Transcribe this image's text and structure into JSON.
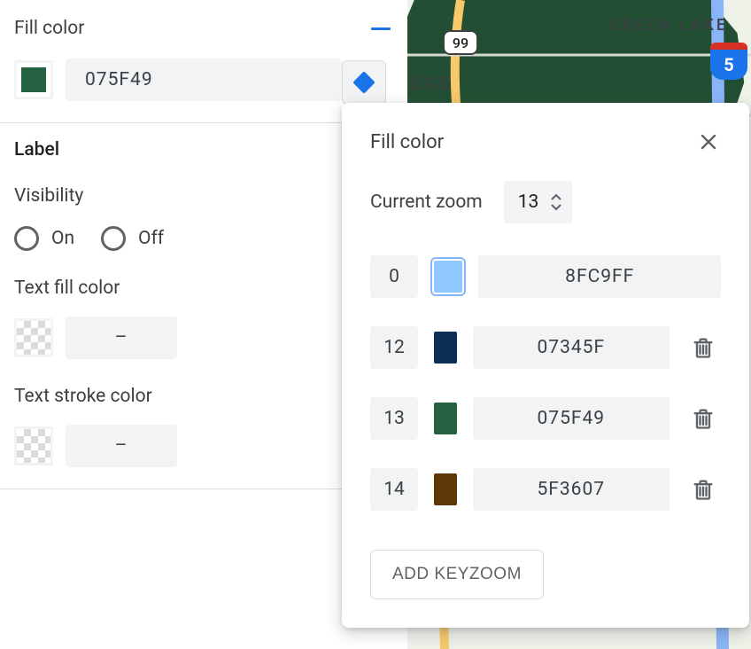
{
  "sidebar": {
    "fill_section_title": "Fill color",
    "fill_hex": "075F49",
    "fill_swatch_color": "#246141",
    "label_section_title": "Label",
    "visibility_label": "Visibility",
    "radio_on": "On",
    "radio_off": "Off",
    "text_fill_label": "Text fill color",
    "text_fill_value": "–",
    "text_stroke_label": "Text stroke color",
    "text_stroke_value": "–"
  },
  "map": {
    "label_greenlake": "GREEN LAKE",
    "label_partial": "DGE",
    "hwy_99": "99",
    "i5": "5"
  },
  "popover": {
    "title": "Fill color",
    "zoom_label": "Current zoom",
    "zoom_value": "13",
    "keyzooms": [
      {
        "zoom": "0",
        "hex": "8FC9FF",
        "color": "#8fc9ff",
        "active": true,
        "deletable": false
      },
      {
        "zoom": "12",
        "hex": "07345F",
        "color": "#0b2e55",
        "active": false,
        "deletable": true
      },
      {
        "zoom": "13",
        "hex": "075F49",
        "color": "#246141",
        "active": false,
        "deletable": true
      },
      {
        "zoom": "14",
        "hex": "5F3607",
        "color": "#5e3707",
        "active": false,
        "deletable": true
      }
    ],
    "add_label": "ADD KEYZOOM"
  }
}
